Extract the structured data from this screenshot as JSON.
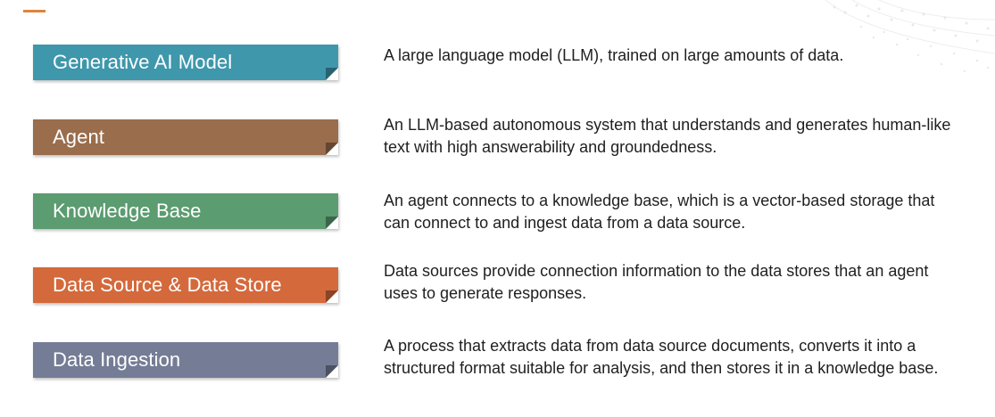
{
  "colors": {
    "accent": "#e0843a",
    "model": "#3f97ac",
    "agent": "#9a6d4c",
    "knowledge": "#5b9c70",
    "datasource": "#d4693c",
    "ingestion": "#747d95"
  },
  "terms": [
    {
      "label": "Generative AI Model",
      "description": "A large language model (LLM), trained on large amounts of data."
    },
    {
      "label": "Agent",
      "description": "An LLM-based autonomous system that understands and generates human-like text with high answerability and groundedness."
    },
    {
      "label": "Knowledge Base",
      "description": "An agent connects to a knowledge base, which is a vector-based storage that can connect to and ingest data from a data source."
    },
    {
      "label": "Data Source & Data Store",
      "description": "Data sources provide connection information to the data stores that an agent uses to generate responses."
    },
    {
      "label": "Data Ingestion",
      "description": "A process that extracts data from data source documents, converts it into a structured format suitable for analysis, and then stores it in a knowledge base."
    }
  ]
}
